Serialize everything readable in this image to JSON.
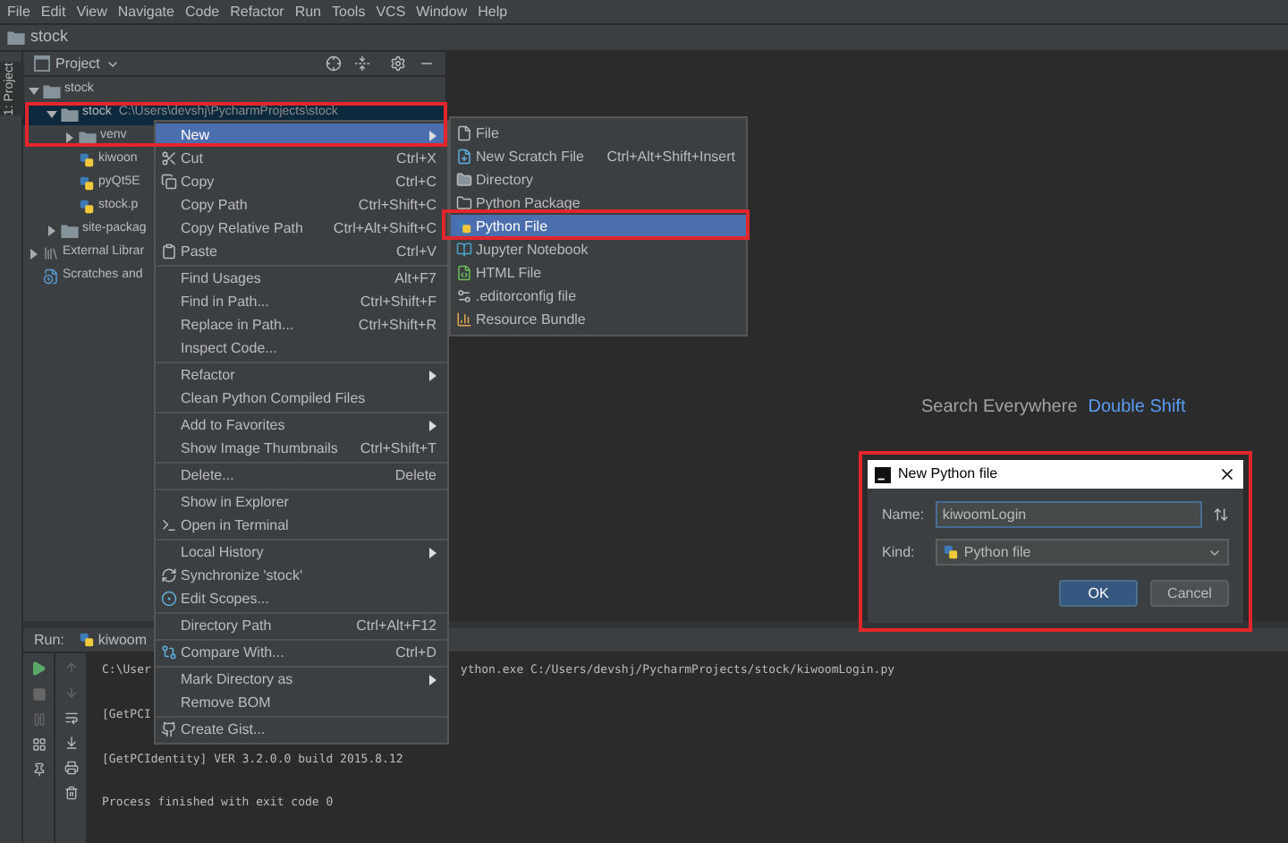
{
  "menu_bar": [
    "File",
    "Edit",
    "View",
    "Navigate",
    "Code",
    "Refactor",
    "Run",
    "Tools",
    "VCS",
    "Window",
    "Help"
  ],
  "breadcrumb": "stock",
  "side_tab": "1: Project",
  "project_panel": {
    "title": "Project",
    "tree": [
      {
        "label": "stock",
        "kind": "folder",
        "expanded": true,
        "selected": false,
        "children": [
          {
            "label": "stock",
            "path": "C:\\Users\\devshj\\PycharmProjects\\stock",
            "kind": "folder",
            "expanded": true,
            "selected": true,
            "children": [
              {
                "label": "venv",
                "kind": "folder",
                "expanded": false,
                "selected": false
              },
              {
                "label": "kiwoon",
                "kind": "python",
                "selected": false
              },
              {
                "label": "pyQt5E",
                "kind": "python",
                "selected": false
              },
              {
                "label": "stock.p",
                "kind": "python",
                "selected": false
              }
            ]
          },
          {
            "label": "site-packag",
            "kind": "folder",
            "expanded": false,
            "selected": false
          }
        ]
      },
      {
        "label": "External Librar",
        "kind": "library",
        "expanded": false,
        "selected": false
      },
      {
        "label": "Scratches and",
        "kind": "scratch",
        "selected": false
      }
    ]
  },
  "editor_hints": [
    {
      "action": "Search Everywhere",
      "shortcut": "Double Shift"
    }
  ],
  "context_menu": {
    "groups": [
      [
        {
          "label": "New",
          "submenu": true,
          "selected": true
        },
        {
          "label": "Cut",
          "shortcut": "Ctrl+X",
          "selected": false
        },
        {
          "label": "Copy",
          "shortcut": "Ctrl+C",
          "selected": false
        },
        {
          "label": "Copy Path",
          "shortcut": "Ctrl+Shift+C",
          "selected": false
        },
        {
          "label": "Copy Relative Path",
          "shortcut": "Ctrl+Alt+Shift+C",
          "selected": false
        },
        {
          "label": "Paste",
          "shortcut": "Ctrl+V",
          "selected": false
        }
      ],
      [
        {
          "label": "Find Usages",
          "shortcut": "Alt+F7",
          "selected": false
        },
        {
          "label": "Find in Path...",
          "shortcut": "Ctrl+Shift+F",
          "selected": false
        },
        {
          "label": "Replace in Path...",
          "shortcut": "Ctrl+Shift+R",
          "selected": false
        },
        {
          "label": "Inspect Code...",
          "selected": false
        }
      ],
      [
        {
          "label": "Refactor",
          "submenu": true,
          "selected": false
        },
        {
          "label": "Clean Python Compiled Files",
          "selected": false
        }
      ],
      [
        {
          "label": "Add to Favorites",
          "submenu": true,
          "selected": false
        },
        {
          "label": "Show Image Thumbnails",
          "shortcut": "Ctrl+Shift+T",
          "selected": false
        }
      ],
      [
        {
          "label": "Delete...",
          "shortcut": "Delete",
          "selected": false
        }
      ],
      [
        {
          "label": "Show in Explorer",
          "selected": false
        },
        {
          "label": "Open in Terminal",
          "selected": false
        }
      ],
      [
        {
          "label": "Local History",
          "submenu": true,
          "selected": false
        },
        {
          "label": "Synchronize 'stock'",
          "selected": false
        },
        {
          "label": "Edit Scopes...",
          "selected": false
        }
      ],
      [
        {
          "label": "Directory Path",
          "shortcut": "Ctrl+Alt+F12",
          "selected": false
        }
      ],
      [
        {
          "label": "Compare With...",
          "shortcut": "Ctrl+D",
          "selected": false
        }
      ],
      [
        {
          "label": "Mark Directory as",
          "submenu": true,
          "selected": false
        },
        {
          "label": "Remove BOM",
          "selected": false
        }
      ],
      [
        {
          "label": "Create Gist...",
          "selected": false
        }
      ]
    ]
  },
  "new_submenu": [
    {
      "label": "File",
      "selected": false
    },
    {
      "label": "New Scratch File",
      "shortcut": "Ctrl+Alt+Shift+Insert",
      "selected": false
    },
    {
      "label": "Directory",
      "selected": false
    },
    {
      "label": "Python Package",
      "selected": false
    },
    {
      "label": "Python File",
      "selected": true
    },
    {
      "label": "Jupyter Notebook",
      "selected": false
    },
    {
      "label": "HTML File",
      "selected": false
    },
    {
      "label": ".editorconfig file",
      "selected": false
    },
    {
      "label": "Resource Bundle",
      "selected": false
    }
  ],
  "run_panel": {
    "label": "Run:",
    "tab": "kiwoom",
    "console": [
      {
        "text": "C:\\User",
        "rest": "ython.exe C:/Users/devshj/PycharmProjects/stock/kiwoomLogin.py"
      },
      {
        "text": "[GetPCI"
      },
      {
        "text": "[GetPCIdentity] VER 3.2.0.0  build 2015.8.12"
      },
      {
        "text": "Process finished with exit code 0"
      }
    ]
  },
  "dialog": {
    "title": "New Python file",
    "name_label": "Name:",
    "name_value": "kiwoomLogin",
    "kind_label": "Kind:",
    "kind_value": "Python file",
    "buttons": [
      {
        "label": "OK",
        "default": true
      },
      {
        "label": "Cancel",
        "default": false
      }
    ]
  }
}
